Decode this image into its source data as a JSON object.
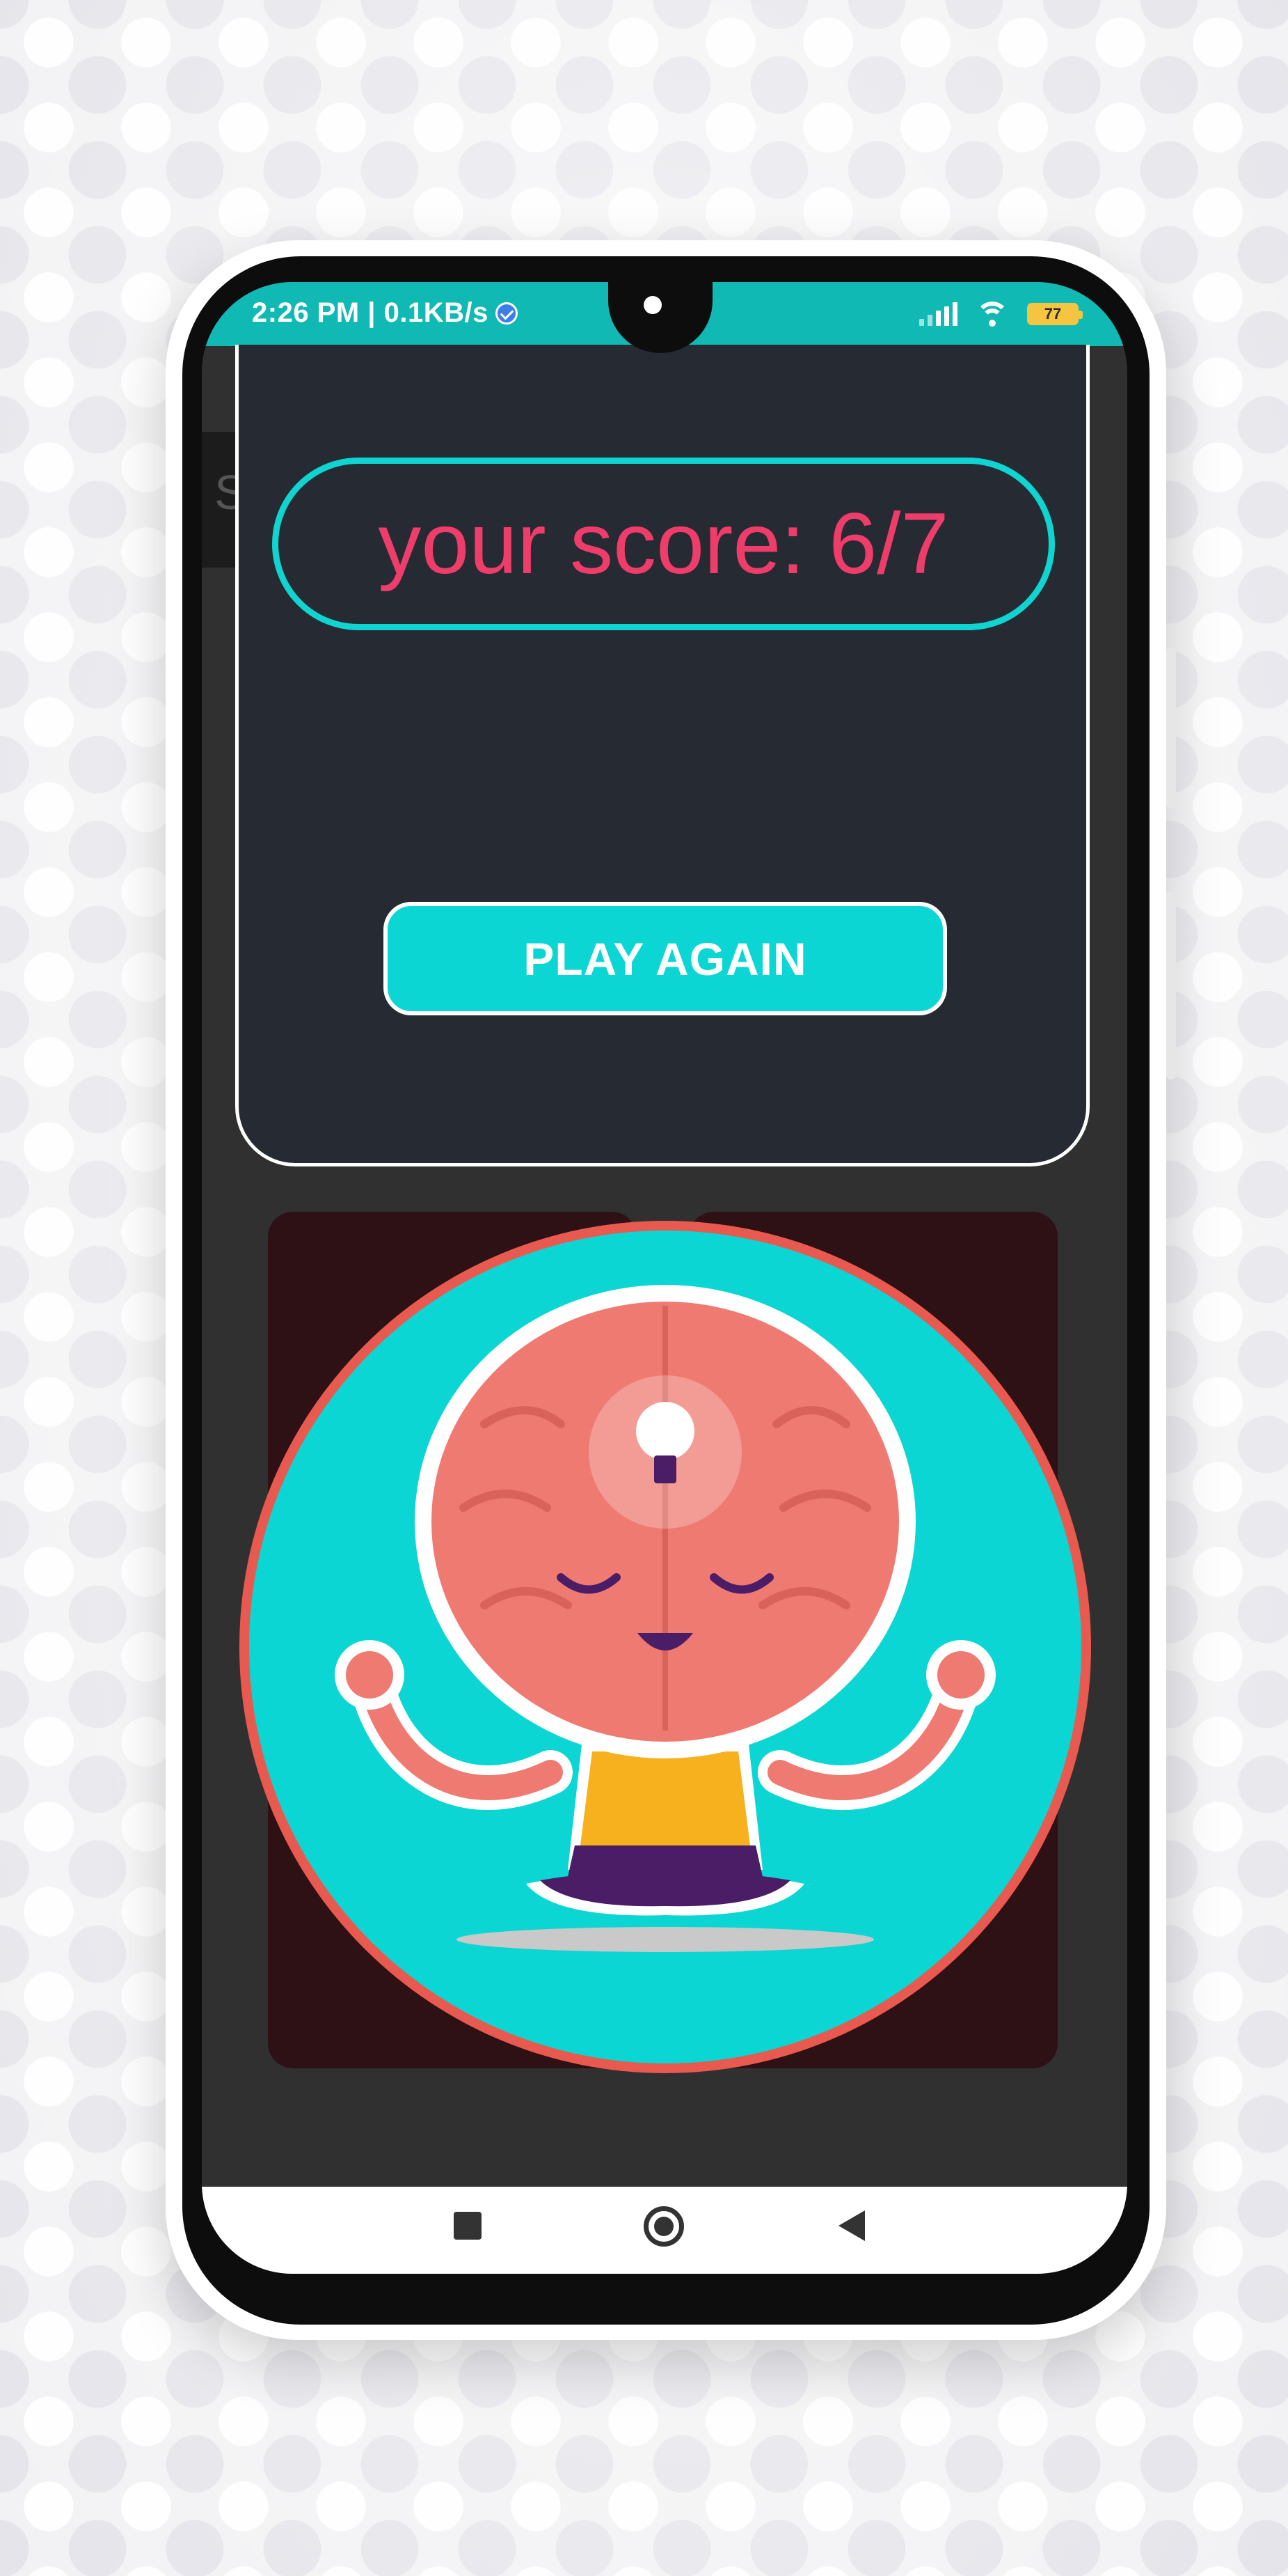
{
  "status_bar": {
    "time_speed": "2:26 PM | 0.1KB/s",
    "battery_level": "77",
    "colors": {
      "background": "#10b9b3"
    }
  },
  "result_card": {
    "score_text": "your score: 6/7",
    "play_again_label": "PLAY AGAIN",
    "colors": {
      "card": "#262a33",
      "score": "#ee3d6b",
      "accent": "#0bd6d3"
    }
  },
  "background_app": {
    "partial_label": "S"
  },
  "mascot": {
    "icon": "meditating-brain-lightbulb-icon",
    "colors": {
      "circle": "#0bd6d3",
      "ring": "#e85a4f",
      "brain": "#ef7a72",
      "shirt": "#f7b11e",
      "pants": "#4a1d66"
    }
  },
  "nav_bar": {
    "icons": [
      "recent-apps-icon",
      "home-icon",
      "back-icon"
    ]
  }
}
